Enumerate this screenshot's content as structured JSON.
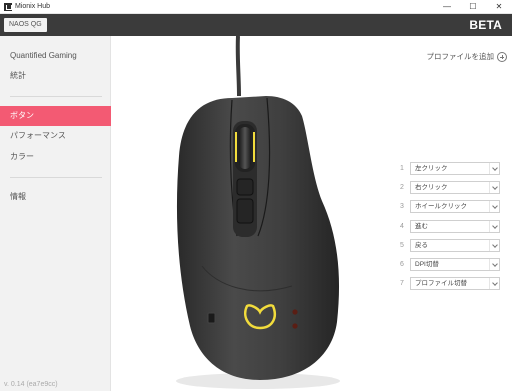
{
  "window": {
    "title": "Mionix Hub",
    "controls": {
      "minimize": "—",
      "maximize": "☐",
      "close": "✕"
    }
  },
  "header": {
    "device_tab": "NAOS QG",
    "badge": "BETA"
  },
  "sidebar": {
    "items": [
      {
        "label": "Quantified Gaming"
      },
      {
        "label": "統計"
      },
      {
        "label": "ボタン"
      },
      {
        "label": "パフォーマンス"
      },
      {
        "label": "カラー"
      },
      {
        "label": "情報"
      }
    ],
    "active_index": 2,
    "version": "v. 0.14 (ea7e9cc)"
  },
  "main": {
    "add_profile_label": "プロファイルを追加",
    "button_assignments": [
      {
        "number": "1",
        "value": "左クリック"
      },
      {
        "number": "2",
        "value": "右クリック"
      },
      {
        "number": "3",
        "value": "ホイールクリック"
      },
      {
        "number": "4",
        "value": "進む"
      },
      {
        "number": "5",
        "value": "戻る"
      },
      {
        "number": "6",
        "value": "DPI切替"
      },
      {
        "number": "7",
        "value": "プロファイル切替"
      }
    ]
  },
  "colors": {
    "accent": "#f35a73",
    "header_bg": "#3b3b3b",
    "sidebar_bg": "#f2f2f2",
    "led_yellow": "#f2dc3c"
  },
  "icons": {
    "add_profile": "plus-circle-icon",
    "dropdown": "chevron-down-icon"
  }
}
